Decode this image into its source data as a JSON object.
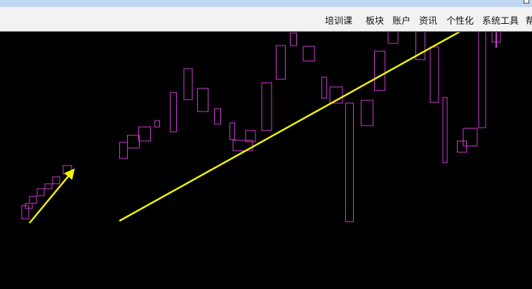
{
  "menu": {
    "items": [
      "培训课",
      "板块",
      "账户",
      "资讯",
      "个性化",
      "系统工具",
      "帮"
    ]
  },
  "colors": {
    "candle": "#d23bd8",
    "trend_arrow": "#f2f200",
    "background": "#000000"
  },
  "chart_data": {
    "type": "candlestick",
    "candles": [
      {
        "open": 25,
        "close": 6
      },
      {
        "open": 28,
        "close": 21
      },
      {
        "open": 38,
        "close": 28
      },
      {
        "open": 49,
        "close": 39
      },
      {
        "open": 56,
        "close": 49
      },
      {
        "open": 66,
        "close": 56
      },
      {
        "open": 82,
        "close": 70
      },
      {
        "open": 115,
        "close": 92
      },
      {
        "open": 125,
        "close": 107
      },
      {
        "open": 137,
        "close": 117
      },
      {
        "open": 146,
        "close": 137
      },
      {
        "open": 186,
        "close": 130
      },
      {
        "open": 220,
        "close": 176
      },
      {
        "open": 192,
        "close": 159
      },
      {
        "open": 163,
        "close": 141
      },
      {
        "open": 143,
        "close": 119
      },
      {
        "open": 118,
        "close": 103
      },
      {
        "open": 132,
        "close": 116
      },
      {
        "open": 200,
        "close": 132
      },
      {
        "open": 253,
        "close": 205
      },
      {
        "open": 271,
        "close": 253
      },
      {
        "open": 252,
        "close": 231
      },
      {
        "open": 208,
        "close": 178
      },
      {
        "open": 194,
        "close": 171
      },
      {
        "open": 171,
        "close": 2
      },
      {
        "open": 175,
        "close": 139
      },
      {
        "open": 245,
        "close": 189
      },
      {
        "open": 308,
        "close": 256
      },
      {
        "open": 330,
        "close": 290
      },
      {
        "open": 298,
        "close": 233
      },
      {
        "open": 251,
        "close": 172
      },
      {
        "open": 179,
        "close": 86
      },
      {
        "open": 117,
        "close": 101
      },
      {
        "open": 135,
        "close": 110
      },
      {
        "open": 289,
        "close": 136
      },
      {
        "open": 286,
        "close": 258
      },
      {
        "open": 319,
        "close": 288
      }
    ],
    "trendlines": [
      {
        "from": [
          0,
          0
        ],
        "to": [
          6,
          76
        ]
      },
      {
        "from": [
          7,
          3
        ],
        "to": [
          36,
          309
        ]
      }
    ],
    "ylim": [
      0,
      350
    ]
  }
}
